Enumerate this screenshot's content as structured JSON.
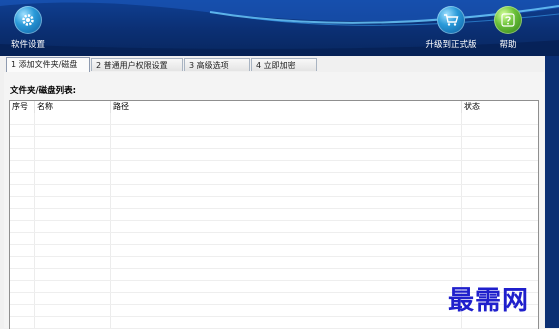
{
  "toolbar": {
    "settings_label": "软件设置",
    "upgrade_label": "升级到正式版",
    "help_label": "帮助"
  },
  "tabs": [
    {
      "label": "1 添加文件夹/磁盘",
      "active": true
    },
    {
      "label": "2 普通用户权限设置",
      "active": false
    },
    {
      "label": "3 高级选项",
      "active": false
    },
    {
      "label": "4 立即加密",
      "active": false
    }
  ],
  "list": {
    "title": "文件夹/磁盘列表:",
    "columns": [
      "序号",
      "名称",
      "路径",
      "状态"
    ],
    "rows": []
  },
  "watermark": "最需网",
  "colors": {
    "banner": "#0b2f73",
    "watermark": "#1f1fcc"
  },
  "icons": {
    "settings": "gear-icon",
    "upgrade": "cart-icon",
    "help": "question-icon"
  }
}
